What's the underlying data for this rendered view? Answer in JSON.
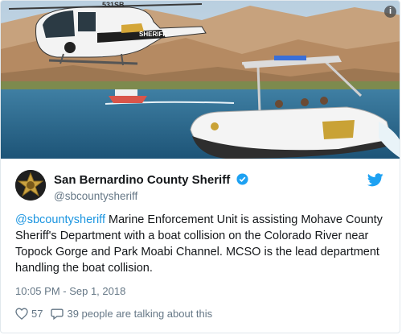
{
  "media": {
    "info_icon": "i",
    "helicopter_text": "SHERIFF",
    "tail_number": "531SB"
  },
  "tweet": {
    "account_name": "San Bernardino County Sheriff",
    "handle": "@sbcountysheriff",
    "mention": "@sbcountysheriff",
    "body": " Marine Enforcement Unit is assisting Mohave County Sheriff's Department with a boat collision on the Colorado River near Topock Gorge and Park Moabi Channel. MCSO is the lead department handling the boat collision.",
    "timestamp": "10:05 PM - Sep 1, 2018",
    "likes": "57",
    "talking": "39 people are talking about this"
  },
  "colors": {
    "link": "#1b95e0",
    "twitter_blue": "#1da1f2",
    "text": "#14171a",
    "muted": "#657786"
  },
  "icons": {
    "verified": "verified-badge-icon",
    "twitter": "twitter-bird-icon",
    "like": "heart-icon",
    "reply": "speech-bubble-icon",
    "info": "info-icon"
  }
}
